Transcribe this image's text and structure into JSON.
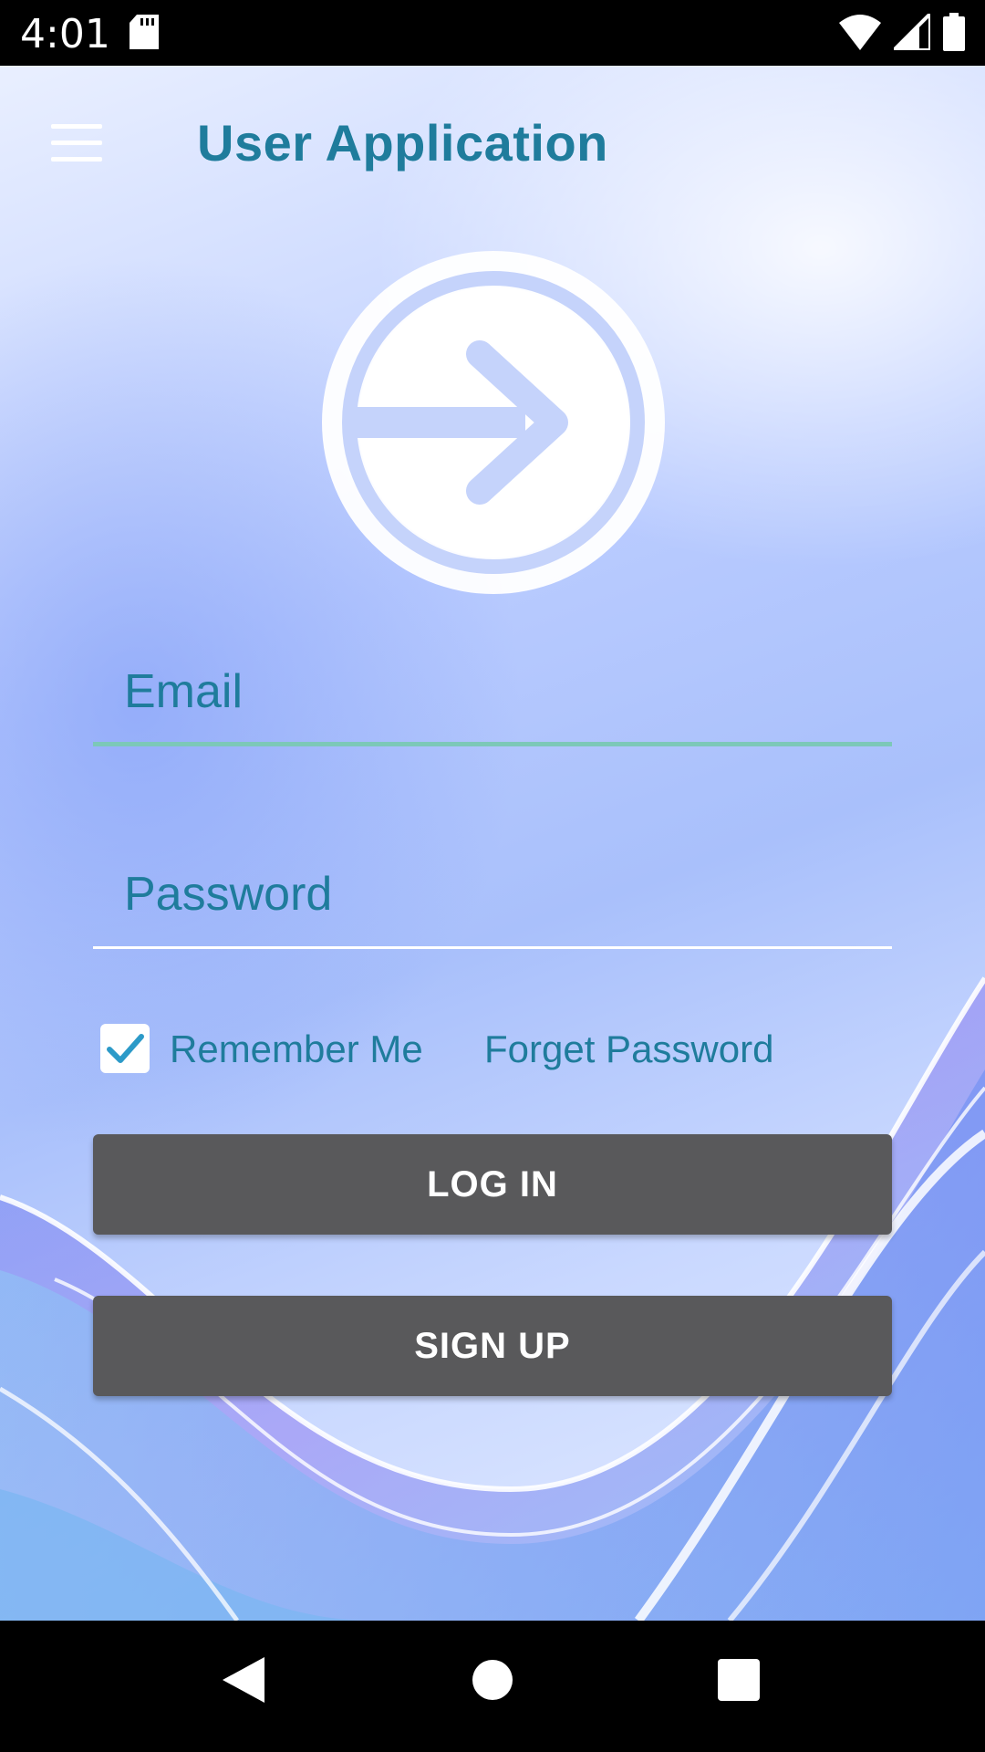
{
  "status_bar": {
    "time": "4:01",
    "icons": [
      "sd-card-icon",
      "wifi-icon",
      "cellular-signal-icon",
      "battery-icon"
    ]
  },
  "header": {
    "menu_icon": "hamburger-menu-icon",
    "title": "User Application"
  },
  "logo": {
    "icon": "login-arrow-circle-icon"
  },
  "form": {
    "email_placeholder": "Email",
    "password_placeholder": "Password",
    "remember_me_label": "Remember Me",
    "remember_me_checked": true,
    "forget_password_label": "Forget Password"
  },
  "buttons": {
    "login_label": "LOG IN",
    "signup_label": "SIGN UP"
  },
  "nav_bar": {
    "icons": [
      "back-icon",
      "home-icon",
      "recents-icon"
    ]
  },
  "colors": {
    "accent": "#1f7c9c",
    "button_bg": "#59595b",
    "email_underline": "#7cc8b8"
  }
}
